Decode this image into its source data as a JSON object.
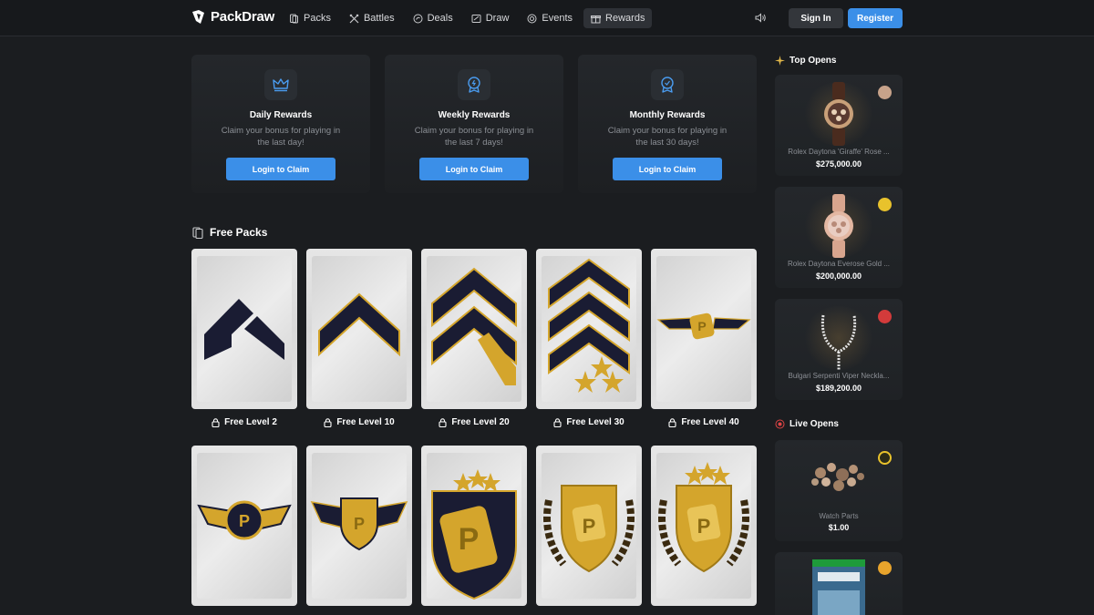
{
  "brand": {
    "name": "PackDraw"
  },
  "nav": {
    "links": [
      {
        "label": "Packs",
        "icon": "pack-icon"
      },
      {
        "label": "Battles",
        "icon": "swords-icon"
      },
      {
        "label": "Deals",
        "icon": "deal-icon"
      },
      {
        "label": "Draw",
        "icon": "draw-icon"
      },
      {
        "label": "Events",
        "icon": "events-icon"
      },
      {
        "label": "Rewards",
        "icon": "gift-icon",
        "active": true
      }
    ],
    "sign_in": "Sign In",
    "register": "Register"
  },
  "rewards": [
    {
      "title": "Daily Rewards",
      "desc": "Claim your bonus for playing in the last day!",
      "button": "Login to Claim",
      "icon": "crown-icon"
    },
    {
      "title": "Weekly Rewards",
      "desc": "Claim your bonus for playing in the last 7 days!",
      "button": "Login to Claim",
      "icon": "medal-icon"
    },
    {
      "title": "Monthly Rewards",
      "desc": "Claim your bonus for playing in the last 30 days!",
      "button": "Login to Claim",
      "icon": "badge-icon"
    }
  ],
  "free_packs": {
    "title": "Free Packs",
    "packs": [
      {
        "label": "Free Level 2"
      },
      {
        "label": "Free Level 10"
      },
      {
        "label": "Free Level 20"
      },
      {
        "label": "Free Level 30"
      },
      {
        "label": "Free Level 40"
      }
    ]
  },
  "top_opens": {
    "title": "Top Opens",
    "items": [
      {
        "name": "Rolex Daytona 'Giraffe' Rose ...",
        "price": "$275,000.00"
      },
      {
        "name": "Rolex Daytona Everose Gold ...",
        "price": "$200,000.00"
      },
      {
        "name": "Bulgari Serpenti Viper Neckla...",
        "price": "$189,200.00"
      }
    ]
  },
  "live_opens": {
    "title": "Live Opens",
    "items": [
      {
        "name": "Watch Parts",
        "price": "$1.00"
      }
    ]
  },
  "colors": {
    "accent": "#3b8fe8",
    "background": "#1b1d20",
    "gold": "#d4a52c",
    "navy": "#1a1c33"
  }
}
